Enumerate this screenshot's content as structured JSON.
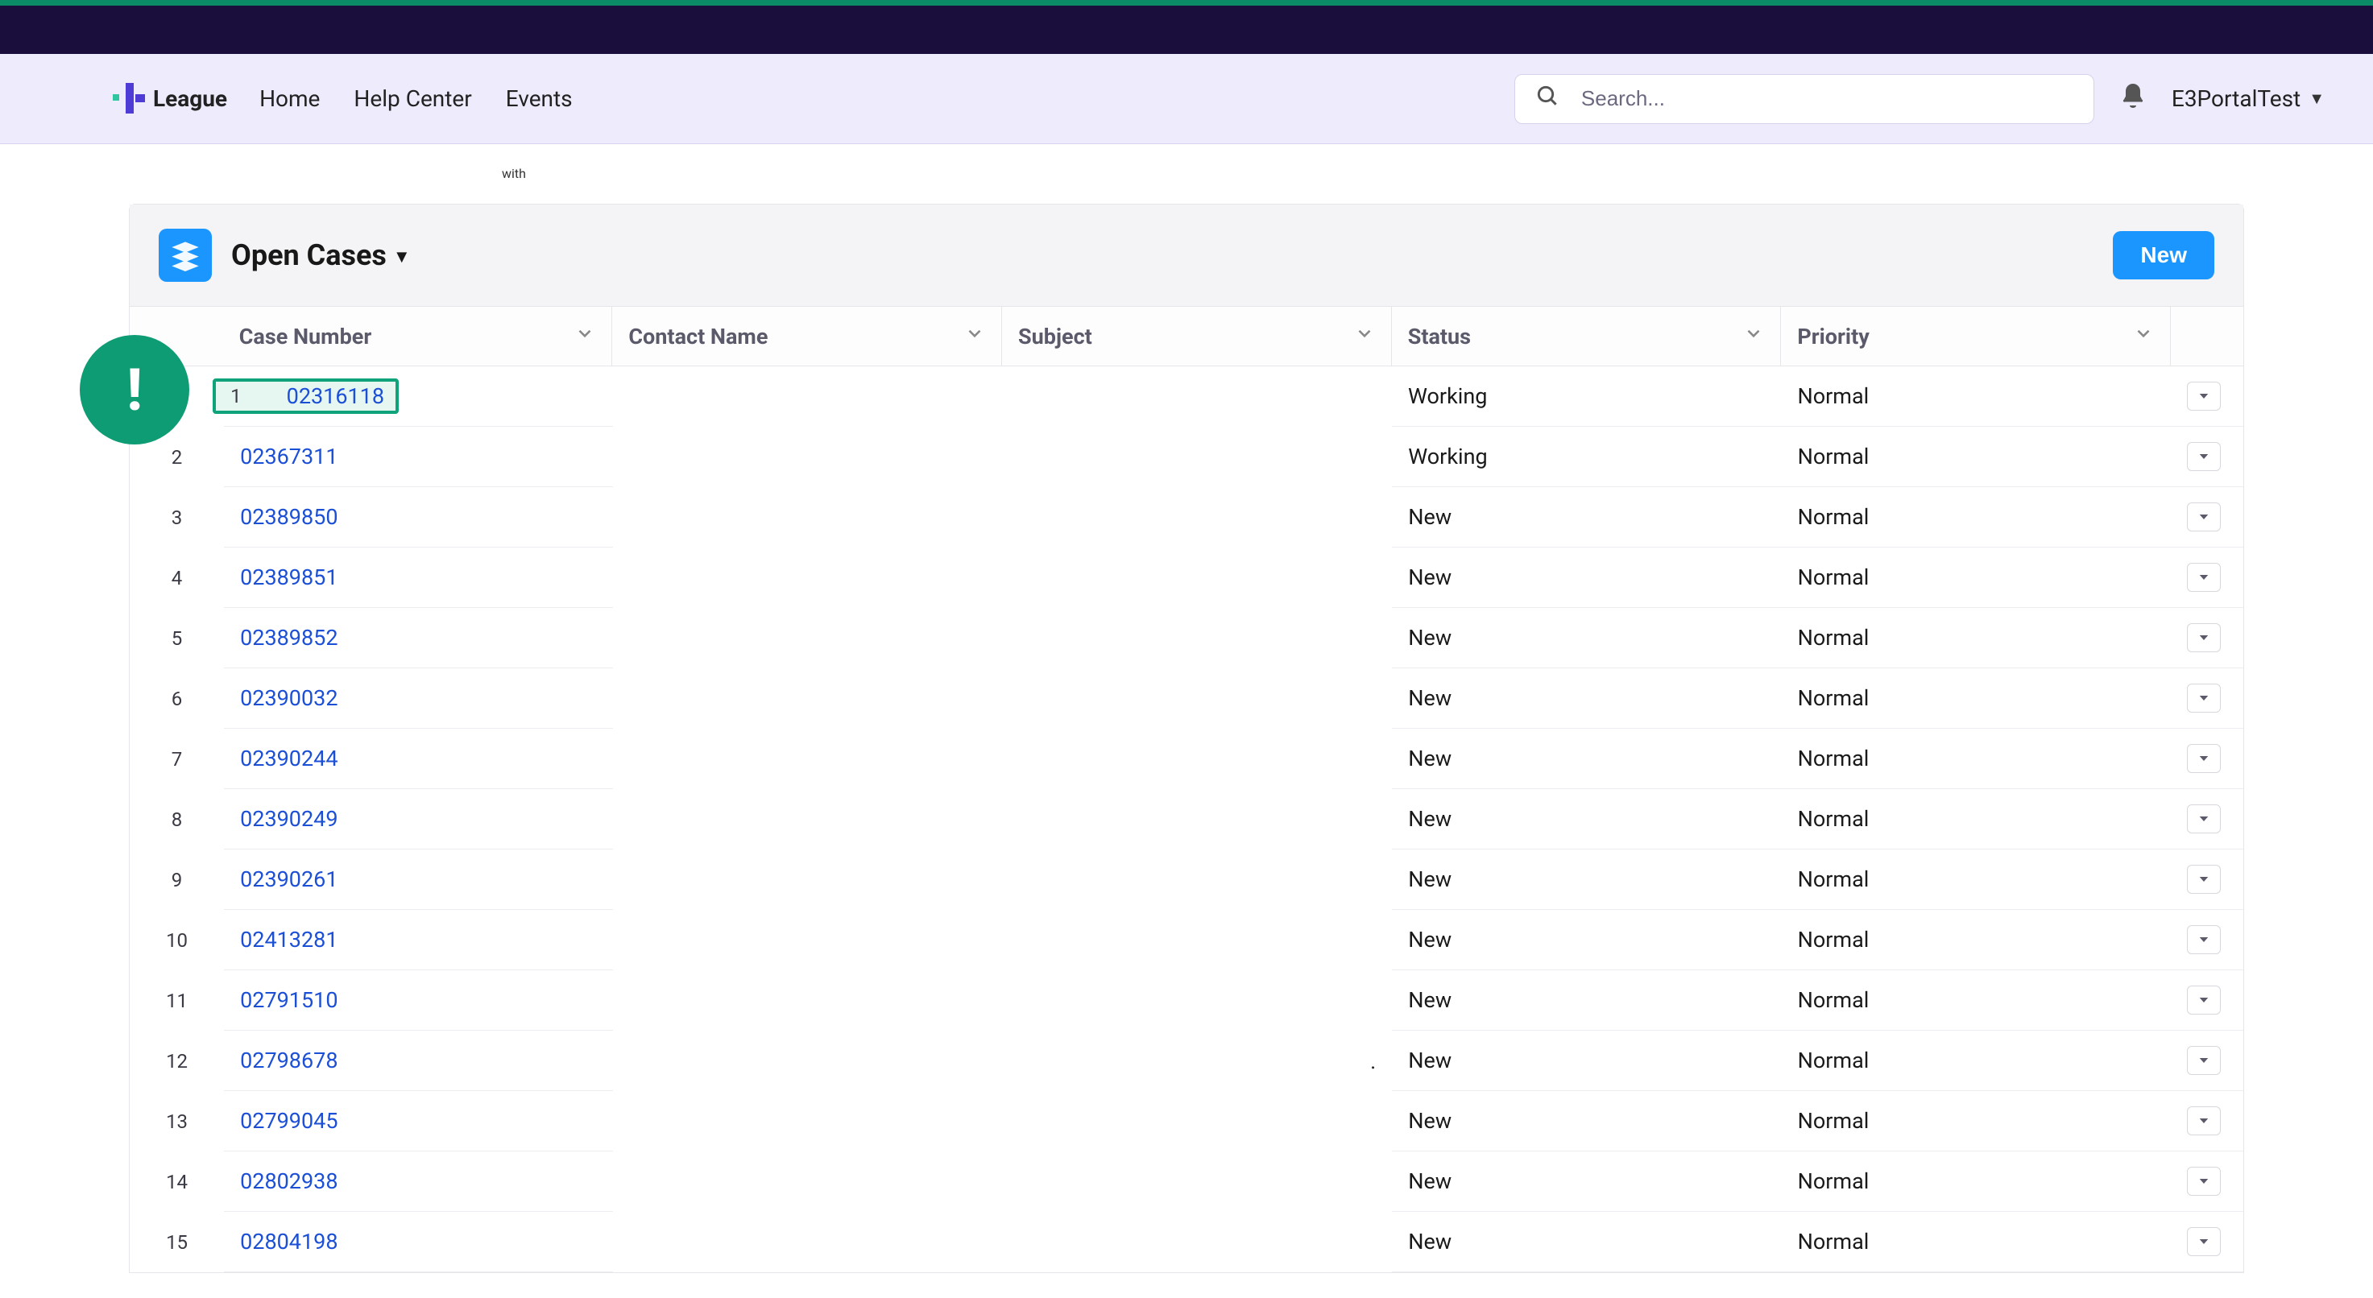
{
  "brand": {
    "name": "League"
  },
  "nav": {
    "links": [
      "Home",
      "Help Center",
      "Events"
    ],
    "search_placeholder": "Search...",
    "user_label": "E3PortalTest"
  },
  "small_label": "with",
  "list": {
    "title": "Open Cases",
    "new_button": "New",
    "columns": {
      "case_number": "Case Number",
      "contact_name": "Contact Name",
      "subject": "Subject",
      "status": "Status",
      "priority": "Priority"
    },
    "rows": [
      {
        "idx": "1",
        "case": "02316118",
        "contact": "",
        "subject": "",
        "status": "Working",
        "priority": "Normal"
      },
      {
        "idx": "2",
        "case": "02367311",
        "contact": "",
        "subject": "",
        "status": "Working",
        "priority": "Normal"
      },
      {
        "idx": "3",
        "case": "02389850",
        "contact": "",
        "subject": "",
        "status": "New",
        "priority": "Normal"
      },
      {
        "idx": "4",
        "case": "02389851",
        "contact": "",
        "subject": "",
        "status": "New",
        "priority": "Normal"
      },
      {
        "idx": "5",
        "case": "02389852",
        "contact": "",
        "subject": "",
        "status": "New",
        "priority": "Normal"
      },
      {
        "idx": "6",
        "case": "02390032",
        "contact": "",
        "subject": "",
        "status": "New",
        "priority": "Normal"
      },
      {
        "idx": "7",
        "case": "02390244",
        "contact": "",
        "subject": "",
        "status": "New",
        "priority": "Normal"
      },
      {
        "idx": "8",
        "case": "02390249",
        "contact": "",
        "subject": "",
        "status": "New",
        "priority": "Normal"
      },
      {
        "idx": "9",
        "case": "02390261",
        "contact": "",
        "subject": "",
        "status": "New",
        "priority": "Normal"
      },
      {
        "idx": "10",
        "case": "02413281",
        "contact": "",
        "subject": "",
        "status": "New",
        "priority": "Normal"
      },
      {
        "idx": "11",
        "case": "02791510",
        "contact": "",
        "subject": "",
        "status": "New",
        "priority": "Normal"
      },
      {
        "idx": "12",
        "case": "02798678",
        "contact": "",
        "subject": ".",
        "status": "New",
        "priority": "Normal"
      },
      {
        "idx": "13",
        "case": "02799045",
        "contact": "",
        "subject": "",
        "status": "New",
        "priority": "Normal"
      },
      {
        "idx": "14",
        "case": "02802938",
        "contact": "",
        "subject": "",
        "status": "New",
        "priority": "Normal"
      },
      {
        "idx": "15",
        "case": "02804198",
        "contact": "",
        "subject": "",
        "status": "New",
        "priority": "Normal"
      }
    ],
    "highlight_index": 0,
    "badge": "!"
  }
}
